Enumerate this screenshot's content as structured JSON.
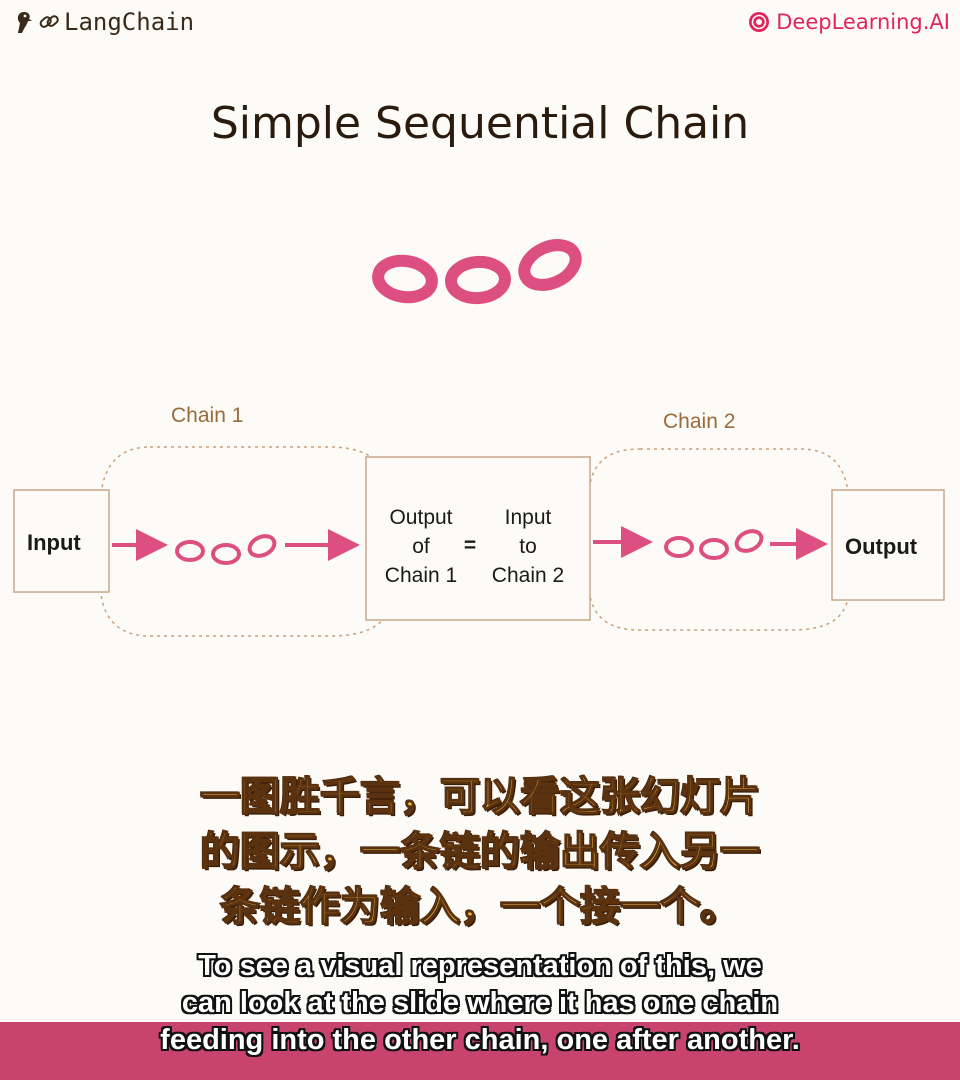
{
  "header": {
    "left_brand": "LangChain",
    "left_icons": [
      "parrot-icon",
      "chain-link-icon"
    ],
    "right_brand": "DeepLearning.AI",
    "right_icon": "deeplearning-logo-icon"
  },
  "slide": {
    "title": "Simple Sequential Chain",
    "chain1_label": "Chain 1",
    "chain2_label": "Chain 2",
    "input_label": "Input",
    "output_label": "Output",
    "middle_left": [
      "Output",
      "of",
      "Chain 1"
    ],
    "equals": "=",
    "middle_right": [
      "Input",
      "to",
      "Chain 2"
    ]
  },
  "subtitles": {
    "chinese": [
      "一图胜千言，可以看这张幻灯片",
      "的图示，一条链的输出传入另一",
      "条链作为输入，一个接一个。"
    ],
    "english": [
      "To see a visual representation of this, we",
      "can look at the slide where it has one chain",
      "feeding into the other chain, one after another."
    ]
  },
  "colors": {
    "accent_pink": "#dd4f80",
    "dashed_outline": "#c9a07a",
    "subtitle_bar": "#c9436f",
    "brand_pink": "#e0245e"
  }
}
